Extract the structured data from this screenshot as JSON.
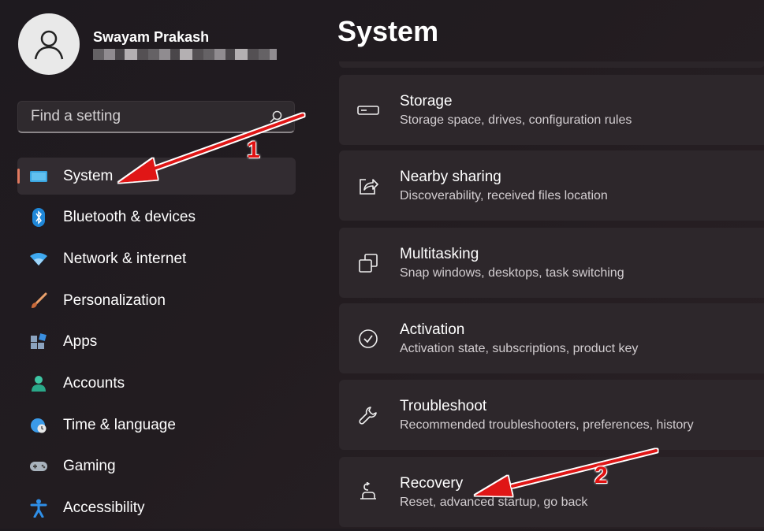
{
  "user": {
    "name": "Swayam Prakash"
  },
  "search": {
    "placeholder": "Find a setting",
    "icon": "search-icon"
  },
  "sidebar": {
    "items": [
      {
        "label": "System",
        "icon": "monitor-icon",
        "active": true
      },
      {
        "label": "Bluetooth & devices",
        "icon": "bluetooth-icon"
      },
      {
        "label": "Network & internet",
        "icon": "wifi-icon"
      },
      {
        "label": "Personalization",
        "icon": "brush-icon"
      },
      {
        "label": "Apps",
        "icon": "apps-icon"
      },
      {
        "label": "Accounts",
        "icon": "person-icon"
      },
      {
        "label": "Time & language",
        "icon": "globe-clock-icon"
      },
      {
        "label": "Gaming",
        "icon": "gamepad-icon"
      },
      {
        "label": "Accessibility",
        "icon": "accessibility-icon"
      }
    ]
  },
  "main": {
    "title": "System",
    "cards": [
      {
        "title": "Storage",
        "subtitle": "Storage space, drives, configuration rules",
        "icon": "storage-icon"
      },
      {
        "title": "Nearby sharing",
        "subtitle": "Discoverability, received files location",
        "icon": "share-icon"
      },
      {
        "title": "Multitasking",
        "subtitle": "Snap windows, desktops, task switching",
        "icon": "multitasking-icon"
      },
      {
        "title": "Activation",
        "subtitle": "Activation state, subscriptions, product key",
        "icon": "check-circle-icon"
      },
      {
        "title": "Troubleshoot",
        "subtitle": "Recommended troubleshooters, preferences, history",
        "icon": "wrench-icon"
      },
      {
        "title": "Recovery",
        "subtitle": "Reset, advanced startup, go back",
        "icon": "recovery-icon"
      }
    ]
  },
  "annotations": {
    "callout_1": "1",
    "callout_2": "2",
    "arrow_color": "#e01212"
  },
  "colors": {
    "accent": "#e1795f",
    "card_bg": "#2d272b",
    "selected_bg": "#322c31"
  }
}
